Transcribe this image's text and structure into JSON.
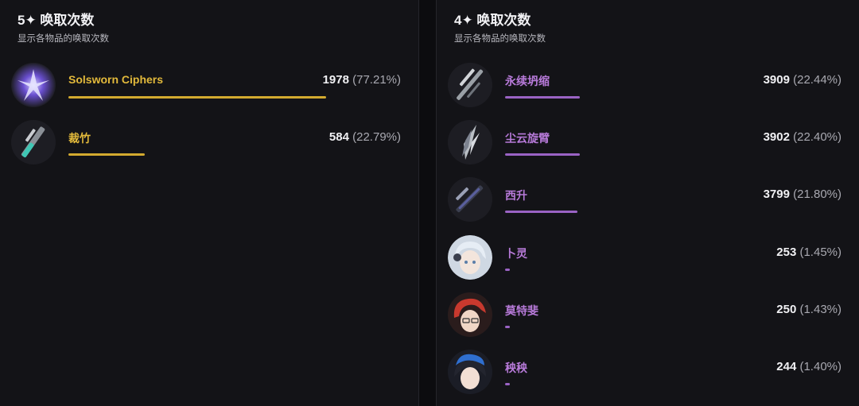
{
  "panels": [
    {
      "title": "5✦ 唤取次数",
      "subtitle": "显示各物品的唤取次数",
      "rarity": "gold",
      "items": [
        {
          "name": "Solsworn Ciphers",
          "count": "1978",
          "percent": "(77.21%)",
          "ratio": 1.0,
          "icon": "crystal-cipher-icon"
        },
        {
          "name": "裁竹",
          "count": "584",
          "percent": "(22.79%)",
          "ratio": 0.295,
          "icon": "blade-weapon-icon"
        }
      ]
    },
    {
      "title": "4✦ 唤取次数",
      "subtitle": "显示各物品的唤取次数",
      "rarity": "purple",
      "items": [
        {
          "name": "永续坍缩",
          "count": "3909",
          "percent": "(22.44%)",
          "ratio": 1.0,
          "icon": "rectifier-weapon-icon"
        },
        {
          "name": "尘云旋臂",
          "count": "3902",
          "percent": "(22.40%)",
          "ratio": 0.998,
          "icon": "gauntlet-weapon-icon"
        },
        {
          "name": "西升",
          "count": "3799",
          "percent": "(21.80%)",
          "ratio": 0.972,
          "icon": "pistol-weapon-icon"
        },
        {
          "name": "卜灵",
          "count": "253",
          "percent": "(1.45%)",
          "ratio": 0.065,
          "icon": "character-portrait-silver-hair-icon"
        },
        {
          "name": "莫特斐",
          "count": "250",
          "percent": "(1.43%)",
          "ratio": 0.064,
          "icon": "character-portrait-red-hair-icon"
        },
        {
          "name": "秧秧",
          "count": "244",
          "percent": "(1.40%)",
          "ratio": 0.062,
          "icon": "character-portrait-dark-hair-icon"
        }
      ]
    }
  ],
  "colors": {
    "gold": "#d3aa2f",
    "purple": "#9a63c4",
    "panel": "#131317",
    "background": "#0c0c0f"
  }
}
